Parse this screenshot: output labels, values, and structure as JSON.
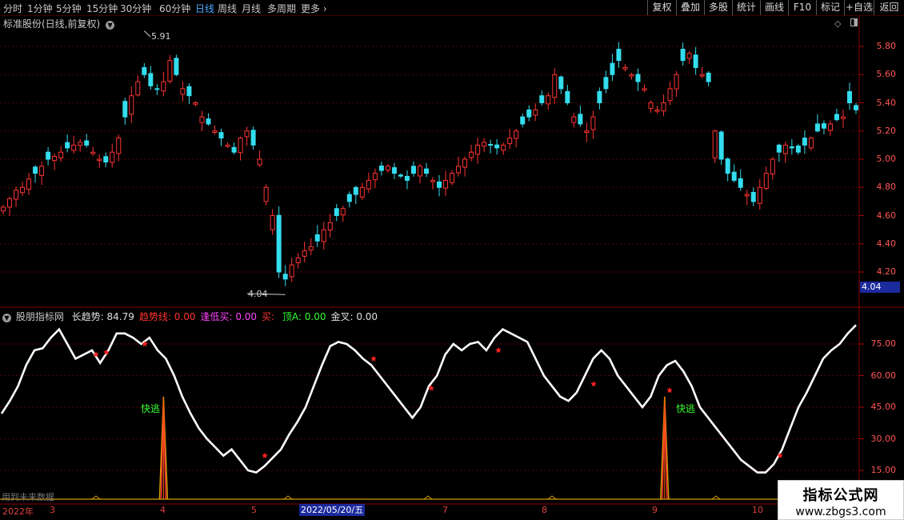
{
  "toolbar": {
    "periods": [
      "分时",
      "1分钟",
      "5分钟",
      "15分钟",
      "30分钟",
      "60分钟",
      "日线",
      "周线",
      "月线",
      "多周期",
      "更多"
    ],
    "active_period": "日线",
    "more_icon": "chevron-right-icon",
    "tools": [
      "复权",
      "叠加",
      "多股",
      "统计",
      "画线",
      "F10",
      "标记",
      "+自选",
      "返回"
    ]
  },
  "price_panel": {
    "title": "标准股份(日线,前复权)",
    "y_ticks": [
      "5.80",
      "5.60",
      "5.40",
      "5.20",
      "5.00",
      "4.80",
      "4.60",
      "4.40",
      "4.20"
    ],
    "high_label": "5.91",
    "low_label": "4.04",
    "cursor_price": "4.04",
    "colors": {
      "up": "#ff3333",
      "down": "#33ddee",
      "grid": "#5a0000"
    }
  },
  "indicator": {
    "name": "股朋指标网",
    "fields": [
      {
        "label": "长趋势:",
        "value": "84.79",
        "color": "#e0e0e0"
      },
      {
        "label": "趋势线:",
        "value": "0.00",
        "color": "#ff3333"
      },
      {
        "label": "逢低买:",
        "value": "0.00",
        "color": "#ff44ff"
      },
      {
        "label": "买:",
        "value": "",
        "color": "#ff3333"
      },
      {
        "label": "顶A:",
        "value": "0.00",
        "color": "#33ff33"
      },
      {
        "label": "金叉:",
        "value": "0.00",
        "color": "#e0e0e0"
      }
    ],
    "y_ticks": [
      "75.00",
      "60.00",
      "45.00",
      "30.00",
      "15.00"
    ],
    "fast_escape_label": "快逃",
    "future_note": "用到未来数据"
  },
  "date_axis": {
    "labels": [
      {
        "text": "2022年"
      },
      {
        "text": "3"
      },
      {
        "text": "4"
      },
      {
        "text": "5"
      },
      {
        "text": "7"
      },
      {
        "text": "8"
      },
      {
        "text": "9"
      },
      {
        "text": "10"
      }
    ],
    "cursor_date": "2022/05/20/五"
  },
  "watermark": {
    "title": "指标公式网",
    "url": "www.zbgs3.com"
  },
  "chart_data": {
    "type": "candlestick",
    "title": "标准股份(日线,前复权)",
    "ylim": [
      4.0,
      5.95
    ],
    "price_marks": {
      "high": 5.91,
      "low": 4.04
    },
    "closes": [
      4.66,
      4.72,
      4.78,
      4.8,
      4.86,
      4.9,
      4.95,
      5.0,
      5.02,
      5.05,
      5.08,
      5.1,
      5.12,
      5.1,
      5.05,
      5.0,
      4.98,
      5.05,
      5.15,
      5.3,
      5.45,
      5.55,
      5.6,
      5.52,
      5.5,
      5.55,
      5.7,
      5.6,
      5.5,
      5.45,
      5.4,
      5.3,
      5.25,
      5.2,
      5.15,
      5.1,
      5.05,
      5.15,
      5.2,
      5.1,
      5.0,
      4.8,
      4.6,
      4.2,
      4.15,
      4.25,
      4.3,
      4.35,
      4.38,
      4.42,
      4.5,
      4.55,
      4.6,
      4.65,
      4.7,
      4.75,
      4.8,
      4.85,
      4.9,
      4.92,
      4.95,
      4.9,
      4.88,
      4.85,
      4.9,
      4.95,
      4.9,
      4.85,
      4.8,
      4.85,
      4.9,
      4.95,
      5.0,
      5.05,
      5.1,
      5.12,
      5.1,
      5.08,
      5.1,
      5.15,
      5.2,
      5.25,
      5.3,
      5.35,
      5.4,
      5.45,
      5.6,
      5.5,
      5.4,
      5.3,
      5.25,
      5.2,
      5.3,
      5.4,
      5.5,
      5.6,
      5.7,
      5.65,
      5.6,
      5.55,
      5.5,
      5.4,
      5.35,
      5.4,
      5.5,
      5.6,
      5.7,
      5.75,
      5.65,
      5.6,
      5.55,
      5.2,
      5.0,
      4.9,
      4.85,
      4.8,
      4.75,
      4.7,
      4.8,
      4.9,
      5.0,
      5.05,
      5.1,
      5.08,
      5.05,
      5.1,
      5.15,
      5.2,
      5.22,
      5.25,
      5.28,
      5.3,
      5.4,
      5.35
    ],
    "series": [
      {
        "name": "长趋势",
        "values": [
          42,
          48,
          55,
          65,
          72,
          73,
          78,
          82,
          75,
          68,
          70,
          72,
          66,
          72,
          80,
          80,
          78,
          75,
          78,
          72,
          68,
          60,
          50,
          42,
          35,
          30,
          26,
          22,
          25,
          20,
          15,
          14,
          17,
          21,
          25,
          32,
          38,
          45,
          55,
          65,
          74,
          76,
          75,
          72,
          68,
          65,
          60,
          55,
          50,
          45,
          40,
          45,
          55,
          60,
          70,
          75,
          72,
          75,
          76,
          72,
          78,
          82,
          80,
          78,
          76,
          68,
          60,
          55,
          50,
          48,
          52,
          60,
          68,
          72,
          68,
          60,
          55,
          50,
          45,
          50,
          60,
          65,
          67,
          62,
          55,
          45,
          40,
          35,
          30,
          25,
          20,
          17,
          14,
          14,
          18,
          25,
          35,
          45,
          52,
          60,
          68,
          72,
          75,
          80,
          84
        ]
      },
      {
        "name": "趋势线",
        "values": [
          0,
          0,
          0,
          0,
          0,
          0,
          0,
          0,
          0,
          0,
          0,
          0,
          0,
          0,
          0,
          0,
          0,
          0,
          0,
          0,
          50,
          0,
          0,
          0,
          0,
          0,
          0,
          0,
          0,
          0,
          0,
          0,
          0,
          0,
          0,
          0,
          0,
          0,
          0,
          0,
          0,
          0,
          0,
          0,
          0,
          0,
          0,
          0,
          0,
          0,
          0,
          0,
          0,
          0,
          0,
          0,
          0,
          0,
          0,
          0,
          0,
          0,
          0,
          0,
          0,
          0,
          0,
          0,
          0,
          0,
          0,
          0,
          0,
          0,
          0,
          0,
          0,
          0,
          0,
          0,
          0,
          50,
          0,
          0,
          0,
          0,
          0,
          0,
          0,
          0,
          0,
          0,
          0,
          0,
          0,
          0,
          0,
          0,
          0,
          0,
          0,
          0,
          0,
          0,
          0
        ]
      }
    ],
    "buy_signals": [
      70,
      71,
      75,
      22,
      68,
      54,
      72,
      56,
      53,
      22
    ],
    "ind_ylim": [
      0,
      90
    ]
  }
}
